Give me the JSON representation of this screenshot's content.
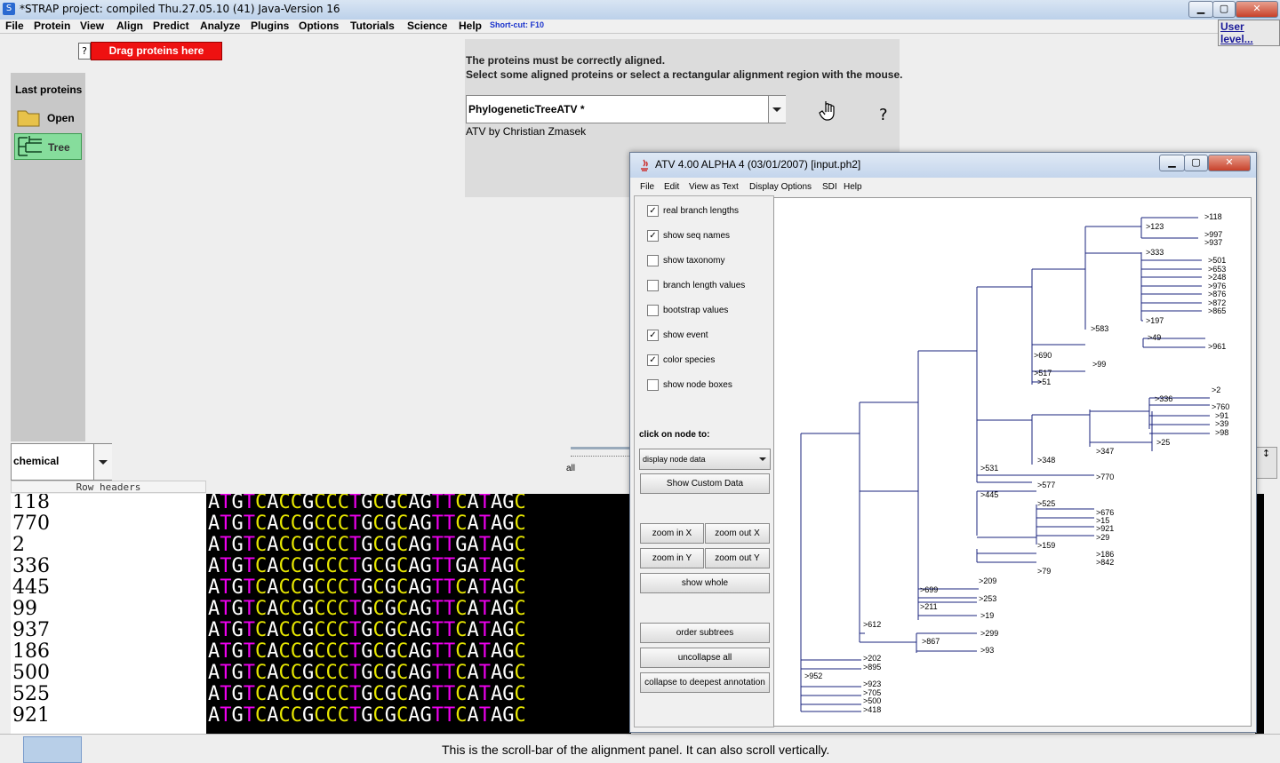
{
  "titlebar": {
    "title": "*STRAP project:  compiled Thu.27.05.10  (41)  Java-Version 16",
    "icon": "strap-icon"
  },
  "menubar": {
    "items": [
      "File",
      "Protein",
      "View",
      "Align",
      "Predict",
      "Analyze",
      "Plugins",
      "Options",
      "Tutorials",
      "Science",
      "Help"
    ],
    "shortcut": "Short-cut: F10",
    "user_level": "User level..."
  },
  "toolbar": {
    "help_q": "?",
    "drag_label": "Drag proteins here"
  },
  "left_panel": {
    "header": "Last proteins",
    "items": [
      {
        "label": "Open",
        "icon": "folder-icon"
      },
      {
        "label": "Tree",
        "icon": "tree-icon"
      }
    ]
  },
  "plugin_panel": {
    "line1": "The proteins must be correctly aligned.",
    "line2": "Select some aligned proteins or select a rectangular alignment region with the mouse.",
    "combo_value": "PhylogeneticTreeATV *",
    "credit": "ATV by Christian Zmasek",
    "help_q": "?"
  },
  "color_combo": {
    "value": "chemical"
  },
  "row_headers_label": "Row headers",
  "slider_label": "all",
  "rows": [
    {
      "name": "118",
      "seq": "ATGTCACCGCCCTGCGCAGTTCATAGC"
    },
    {
      "name": "770",
      "seq": "ATGTCACCGCCCTGCGCAGTTCATAGC"
    },
    {
      "name": "2",
      "seq": "ATGTCACCGCCCTGCGCAGTTGATAGC"
    },
    {
      "name": "336",
      "seq": "ATGTCACCGCCCTGCGCAGTTGATAGC"
    },
    {
      "name": "445",
      "seq": "ATGTCACCGCCCTGCGCAGTTCATAGC"
    },
    {
      "name": "99",
      "seq": "ATGTCACCGCCCTGCGCAGTTCATAGC"
    },
    {
      "name": "937",
      "seq": "ATGTCACCGCCCTGCGCAGTTCATAGC"
    },
    {
      "name": "186",
      "seq": "ATGTCACCGCCCTGCGCAGTTCATAGC"
    },
    {
      "name": "500",
      "seq": "ATGTCACCGCCCTGCGCAGTTCATAGC"
    },
    {
      "name": "525",
      "seq": "ATGTCACCGCCCTGCGCAGTTCATAGC"
    },
    {
      "name": "921",
      "seq": "ATGTCACCGCCCTGCGCAGTTCATAGC"
    }
  ],
  "base_colors": {
    "A": "#ffffff",
    "T": "#ee00ee",
    "G": "#ffffff",
    "C": "#e6e600"
  },
  "status": "This is the scroll-bar of the alignment panel. It can also scroll vertically.",
  "atv": {
    "title": "ATV 4.00 ALPHA 4 (03/01/2007) [input.ph2]",
    "menu": [
      "File",
      "Edit",
      "View as Text",
      "Display Options",
      "SDI",
      "Help"
    ],
    "checkboxes": [
      {
        "label": "real branch lengths",
        "checked": true
      },
      {
        "label": "show seq names",
        "checked": true
      },
      {
        "label": "show taxonomy",
        "checked": false
      },
      {
        "label": "branch length values",
        "checked": false
      },
      {
        "label": "bootstrap values",
        "checked": false
      },
      {
        "label": "show event",
        "checked": true
      },
      {
        "label": "color species",
        "checked": true
      },
      {
        "label": "show node boxes",
        "checked": false
      }
    ],
    "click_label": "click on node to:",
    "click_select": "display node data",
    "buttons": {
      "show_custom": "Show Custom Data",
      "zoom_in_x": "zoom in X",
      "zoom_out_x": "zoom out X",
      "zoom_in_y": "zoom in Y",
      "zoom_out_y": "zoom out Y",
      "show_whole": "show whole",
      "order_subtrees": "order subtrees",
      "uncollapse_all": "uncollapse all",
      "collapse_deepest": "collapse to deepest annotation"
    },
    "tree_labels": [
      ">118",
      ">123",
      ">997",
      ">937",
      ">333",
      ">501",
      ">653",
      ">248",
      ">976",
      ">876",
      ">872",
      ">865",
      ">197",
      ">583",
      ">49",
      ">961",
      ">690",
      ">99",
      ">517",
      ">51",
      ">2",
      ">336",
      ">760",
      ">91",
      ">39",
      ">98",
      ">25",
      ">347",
      ">348",
      ">531",
      ">770",
      ">577",
      ">445",
      ">525",
      ">676",
      ">15",
      ">921",
      ">29",
      ">159",
      ">186",
      ">842",
      ">79",
      ">209",
      ">699",
      ">253",
      ">211",
      ">19",
      ">612",
      ">299",
      ">867",
      ">93",
      ">202",
      ">895",
      ">952",
      ">923",
      ">705",
      ">500",
      ">418"
    ]
  }
}
